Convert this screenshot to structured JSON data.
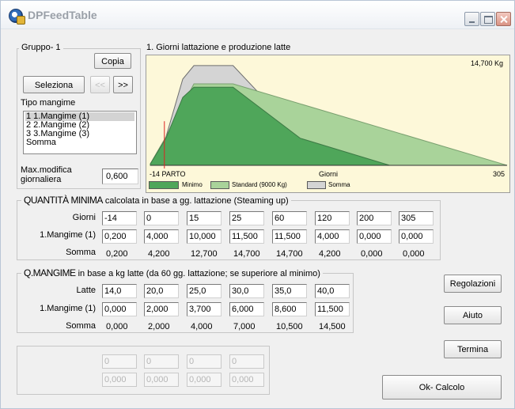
{
  "window": {
    "title": "DPFeedTable"
  },
  "group": {
    "label": "Gruppo- 1",
    "copy_button": "Copia",
    "select_button": "Seleziona",
    "prev_button": "<<",
    "next_button": ">>",
    "feed_type_label": "Tipo mangime",
    "feed_list": [
      "1 1.Mangime (1)",
      "2 2.Mangime (2)",
      "3 3.Mangime (3)",
      "Somma"
    ],
    "max_mod_label_1": "Max.modifica",
    "max_mod_label_2": "giornaliera",
    "max_mod_value": "0,600"
  },
  "chart": {
    "title": "1. Giorni lattazione e produzione latte",
    "peak_label": "14,700 Kg",
    "x_start_label": "-14 PARTO",
    "x_axis_label": "Giorni",
    "x_end_label": "305",
    "legend": [
      {
        "name": "Minimo",
        "color": "#4fa65a"
      },
      {
        "name": "Standard (9000 Kg)",
        "color": "#a9d39a"
      },
      {
        "name": "Somma",
        "color": "#d4d4d4"
      }
    ]
  },
  "chart_data": {
    "type": "area",
    "title": "1. Giorni lattazione e produzione latte",
    "xlabel": "Giorni",
    "xlim": [
      -14,
      305
    ],
    "series": [
      {
        "name": "Somma",
        "x": [
          -14,
          0,
          15,
          25,
          60,
          120,
          200,
          305
        ],
        "values": [
          0.2,
          4.2,
          12.7,
          14.7,
          14.7,
          4.2,
          0,
          0
        ]
      },
      {
        "name": "Standard (9000 Kg)",
        "x": [
          -14,
          0,
          25,
          60,
          305
        ],
        "values": [
          0.2,
          4.2,
          12.0,
          12.0,
          0
        ]
      },
      {
        "name": "Minimo",
        "x": [
          -14,
          0,
          15,
          25,
          60,
          120,
          200,
          305
        ],
        "values": [
          0.2,
          4.0,
          10.0,
          11.5,
          11.5,
          4.0,
          0,
          0
        ]
      }
    ]
  },
  "quantita": {
    "title": "QUANTITÀ MINIMA",
    "subtitle": "calcolata in base a gg. lattazione (Steaming up)",
    "row_labels": [
      "Giorni",
      "1.Mangime (1)",
      "Somma"
    ],
    "giorni": [
      "-14",
      "0",
      "15",
      "25",
      "60",
      "120",
      "200",
      "305"
    ],
    "mangime1": [
      "0,200",
      "4,000",
      "10,000",
      "11,500",
      "11,500",
      "4,000",
      "0,000",
      "0,000"
    ],
    "somma": [
      "0,200",
      "4,200",
      "12,700",
      "14,700",
      "14,700",
      "4,200",
      "0,000",
      "0,000"
    ]
  },
  "qmangime": {
    "title": "Q.MANGIME",
    "subtitle": "in base a kg latte (da 60 gg. lattazione; se superiore al minimo)",
    "row_labels": [
      "Latte",
      "1.Mangime (1)",
      "Somma"
    ],
    "latte": [
      "14,0",
      "20,0",
      "25,0",
      "30,0",
      "35,0",
      "40,0"
    ],
    "mangime1": [
      "0,000",
      "2,000",
      "3,700",
      "6,000",
      "8,600",
      "11,500"
    ],
    "somma": [
      "0,000",
      "2,000",
      "4,000",
      "7,000",
      "10,500",
      "14,500"
    ]
  },
  "disabled_grid": {
    "row1": [
      "0",
      "0",
      "0",
      "0"
    ],
    "row2": [
      "0,000",
      "0,000",
      "0,000",
      "0,000"
    ]
  },
  "buttons": {
    "regolazioni": "Regolazioni",
    "aiuto": "Aiuto",
    "termina": "Termina",
    "ok_calcolo": "Ok- Calcolo"
  }
}
